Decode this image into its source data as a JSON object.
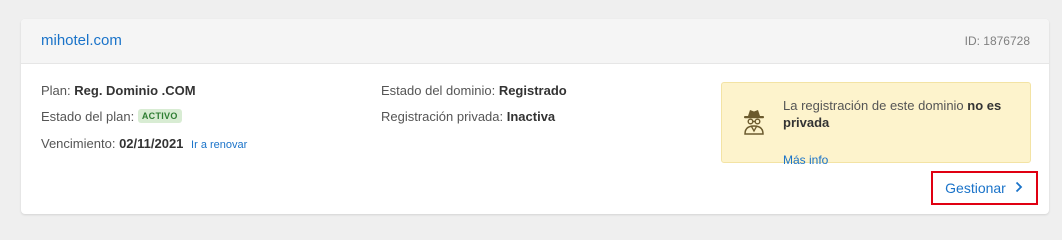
{
  "domain": {
    "name": "mihotel.com",
    "id_text": "ID: 1876728"
  },
  "details": {
    "plan_label": "Plan:",
    "plan_value": "Reg. Dominio .COM",
    "plan_status_label": "Estado del plan:",
    "plan_status_badge": "ACTIVO",
    "expiry_label": "Vencimiento:",
    "expiry_value": "02/11/2021",
    "renew_link": "Ir a renovar",
    "domain_status_label": "Estado del dominio:",
    "domain_status_value": "Registrado",
    "private_reg_label": "Registración privada:",
    "private_reg_value": "Inactiva"
  },
  "notice": {
    "icon": "spy-icon",
    "text_prefix": "La registración de este dominio",
    "text_bold": "no es privada",
    "link": "Más info"
  },
  "actions": {
    "manage_label": "Gestionar"
  },
  "colors": {
    "link": "#1a73c9",
    "badge_bg": "#d8ecd3",
    "badge_text": "#2e7d32",
    "notice_bg": "#fdf3cc",
    "highlight_border": "#e00012"
  }
}
